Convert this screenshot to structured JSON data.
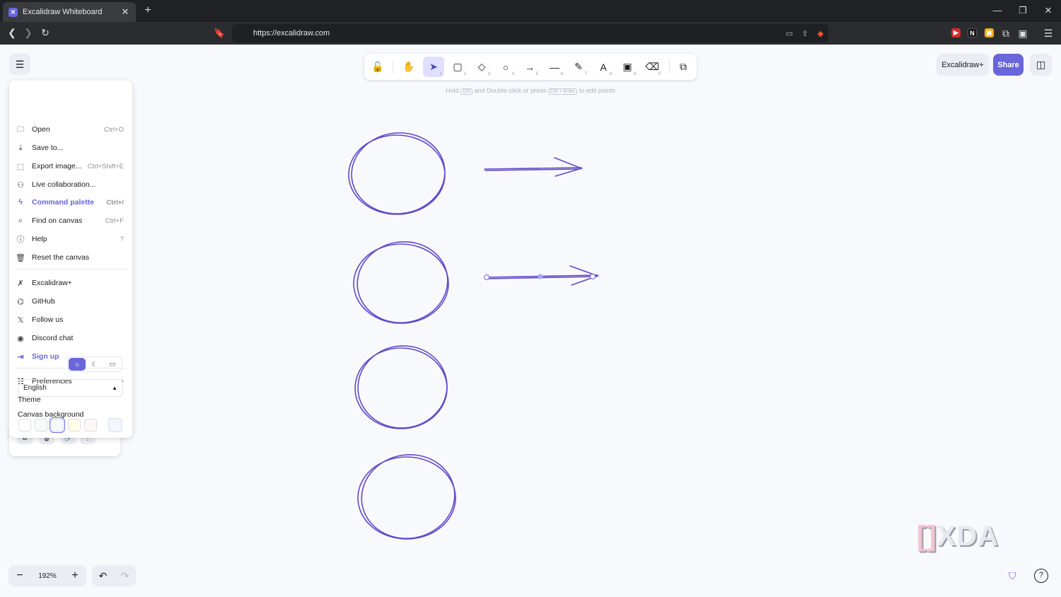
{
  "browser": {
    "tab_title": "Excalidraw Whiteboard",
    "url": "https://excalidraw.com",
    "icons": {
      "back": "chevron-left-icon",
      "forward": "chevron-right-icon",
      "reload": "reload-icon",
      "bookmark": "bookmark-icon",
      "site_settings": "site-settings-icon"
    }
  },
  "toolbar": {
    "tools": [
      {
        "id": "lock",
        "glyph": "🔓",
        "key": ""
      },
      {
        "id": "hand",
        "glyph": "✋",
        "key": ""
      },
      {
        "id": "selection",
        "glyph": "➤",
        "key": "1"
      },
      {
        "id": "rectangle",
        "glyph": "▢",
        "key": "2"
      },
      {
        "id": "diamond",
        "glyph": "◇",
        "key": "3"
      },
      {
        "id": "ellipse",
        "glyph": "○",
        "key": "4"
      },
      {
        "id": "arrow",
        "glyph": "→",
        "key": "5"
      },
      {
        "id": "line",
        "glyph": "—",
        "key": "6"
      },
      {
        "id": "draw",
        "glyph": "✎",
        "key": "7"
      },
      {
        "id": "text",
        "glyph": "A",
        "key": "8"
      },
      {
        "id": "image",
        "glyph": "▣",
        "key": "9"
      },
      {
        "id": "eraser",
        "glyph": "⌫",
        "key": "0"
      },
      {
        "id": "library",
        "glyph": "⧉",
        "key": ""
      }
    ],
    "active_tool": "selection",
    "hint": {
      "prefix": "Hold",
      "key1": "Ctrl",
      "middle": "and Double-click or press",
      "key2": "Ctrl + Enter",
      "suffix": "to edit points"
    }
  },
  "header": {
    "excalidraw_plus_label": "Excalidraw+",
    "share_label": "Share",
    "accent_color": "#6965db"
  },
  "menu": {
    "items": [
      {
        "label": "Open",
        "shortcut": "Ctrl+O",
        "icon": "folder-icon"
      },
      {
        "label": "Save to...",
        "shortcut": "",
        "icon": "download-icon"
      },
      {
        "label": "Export image...",
        "shortcut": "Ctrl+Shift+E",
        "icon": "export-image-icon"
      },
      {
        "label": "Live collaboration...",
        "shortcut": "",
        "icon": "users-icon"
      },
      {
        "label": "Command palette",
        "shortcut": "Ctrl+/",
        "icon": "bolt-icon"
      },
      {
        "label": "Find on canvas",
        "shortcut": "Ctrl+F",
        "icon": "search-icon"
      },
      {
        "label": "Help",
        "shortcut": "?",
        "icon": "help-icon"
      },
      {
        "label": "Reset the canvas",
        "shortcut": "",
        "icon": "trash-icon"
      }
    ],
    "links": [
      {
        "label": "Excalidraw+",
        "icon": "excalidraw-logo-icon"
      },
      {
        "label": "GitHub",
        "icon": "github-icon"
      },
      {
        "label": "Follow us",
        "icon": "x-logo-icon"
      },
      {
        "label": "Discord chat",
        "icon": "discord-icon"
      },
      {
        "label": "Sign up",
        "icon": "sign-up-icon"
      }
    ],
    "preferences_label": "Preferences",
    "theme_label": "Theme",
    "theme_selected": "light",
    "language": "English",
    "canvas_background_label": "Canvas background",
    "canvas_background_swatches": [
      "#ffffff",
      "#f8f9fa",
      "#f5faff",
      "#fffce8",
      "#fdf8f6",
      "#f3f7fd"
    ],
    "canvas_background_selected": 2
  },
  "zoom": {
    "value": "192%",
    "minus": "−",
    "plus": "+"
  },
  "history": {
    "undo": "↶",
    "redo": "↷"
  },
  "watermark": {
    "text": "XDA"
  },
  "canvas": {
    "stroke_color": "#6248c8",
    "shapes": [
      "ellipse",
      "ellipse",
      "ellipse",
      "ellipse",
      "arrow",
      "arrow-selected"
    ]
  }
}
